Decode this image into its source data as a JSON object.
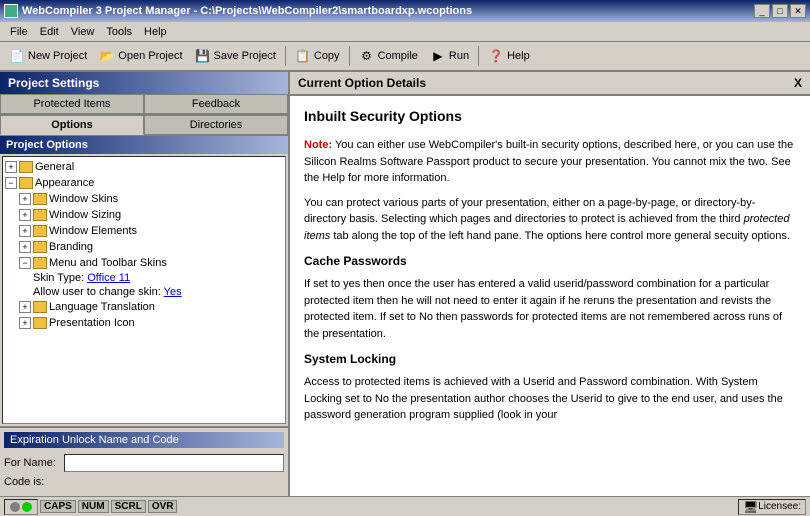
{
  "titlebar": {
    "title": "WebCompiler 3 Project Manager - C:\\Projects\\WebCompiler2\\smartboardxp.wcoptions",
    "min_label": "_",
    "max_label": "□",
    "close_label": "✕"
  },
  "menubar": {
    "items": [
      "File",
      "Edit",
      "View",
      "Tools",
      "Help"
    ]
  },
  "toolbar": {
    "buttons": [
      {
        "label": "New Project",
        "icon": "📄"
      },
      {
        "label": "Open Project",
        "icon": "📂"
      },
      {
        "label": "Save Project",
        "icon": "💾"
      },
      {
        "label": "Copy",
        "icon": "📋"
      },
      {
        "label": "Compile",
        "icon": "⚙"
      },
      {
        "label": "Run",
        "icon": "▶"
      },
      {
        "label": "Help",
        "icon": "❓"
      }
    ]
  },
  "left_panel": {
    "title": "Project Settings",
    "tabs_row1": [
      {
        "label": "Protected Items",
        "active": false
      },
      {
        "label": "Feedback",
        "active": false
      }
    ],
    "tabs_row2": [
      {
        "label": "Options",
        "active": true
      },
      {
        "label": "Directories",
        "active": false
      }
    ],
    "tree_title": "Project Options",
    "tree_nodes": [
      {
        "id": "general",
        "label": "General",
        "level": 0,
        "expanded": true,
        "type": "folder"
      },
      {
        "id": "appearance",
        "label": "Appearance",
        "level": 0,
        "expanded": true,
        "type": "folder"
      },
      {
        "id": "window-skins",
        "label": "Window Skins",
        "level": 1,
        "expanded": false,
        "type": "folder"
      },
      {
        "id": "window-sizing",
        "label": "Window Sizing",
        "level": 1,
        "expanded": false,
        "type": "folder"
      },
      {
        "id": "window-elements",
        "label": "Window Elements",
        "level": 1,
        "expanded": false,
        "type": "folder"
      },
      {
        "id": "branding",
        "label": "Branding",
        "level": 1,
        "expanded": false,
        "type": "folder"
      },
      {
        "id": "menu-toolbar-skins",
        "label": "Menu and Toolbar Skins",
        "level": 1,
        "expanded": true,
        "type": "folder"
      },
      {
        "id": "skin-type",
        "label": "Skin Type:",
        "level": 2,
        "link": "Office 11",
        "type": "value"
      },
      {
        "id": "allow-skin",
        "label": "Allow user to change skin:",
        "level": 2,
        "link": "Yes",
        "type": "value"
      },
      {
        "id": "language-translation",
        "label": "Language Translation",
        "level": 1,
        "expanded": false,
        "type": "folder"
      },
      {
        "id": "presentation-icon",
        "label": "Presentation Icon",
        "level": 1,
        "expanded": false,
        "type": "folder"
      }
    ],
    "unlock_section": {
      "title": "Expiration Unlock Name and Code",
      "for_name_label": "For Name:",
      "for_name_value": "",
      "code_is_label": "Code is:"
    }
  },
  "right_panel": {
    "header": "Current Option Details",
    "close_label": "X",
    "content": {
      "heading": "Inbuilt Security Options",
      "note_label": "Note:",
      "note_text": " You can either use WebCompiler's built-in security options, described here, or you can use the Silicon Realms Software Passport product to secure your presentation. You cannot mix the two. See the Help for more information.",
      "para1": "You can protect various parts of your presentation, either on a page-by-page, or directory-by-directory basis. Selecting which pages and directories to protect is achieved from the third protected items tab along the top of the left hand pane. The options here control more general secuity options.",
      "heading2": "Cache Passwords",
      "para2": "If set to yes then once the user has entered a valid userid/password combination for a particular protected item then he will not need to enter it again if he reruns the presentation and revists the protected item. If set to No then passwords for protected items are not remembered across runs of the presentation.",
      "heading3": "System Locking",
      "para3": "Access to protected items is achieved with a Userid and Password combination. With System Locking set to No the presentation author chooses the Userid to give to the end user, and uses the password generation program supplied (look in your"
    }
  },
  "statusbar": {
    "caps_label": "CAPS",
    "num_label": "NUM",
    "scrl_label": "SCRL",
    "ovr_label": "OVR",
    "licensee_label": "Licensee:"
  }
}
